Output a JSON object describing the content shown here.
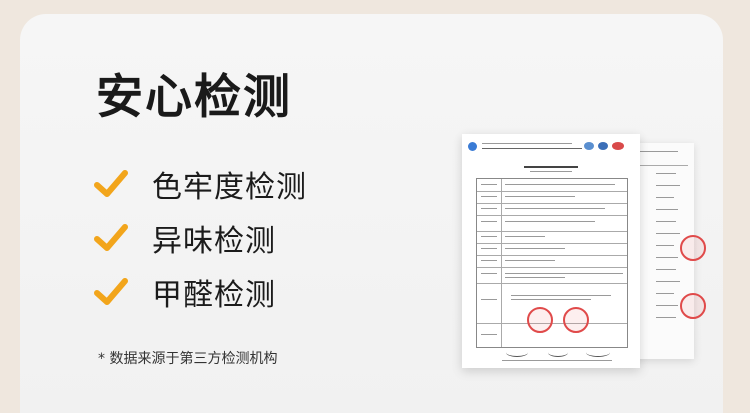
{
  "title": "安心检测",
  "items": [
    {
      "label": "色牢度检测"
    },
    {
      "label": "异味检测"
    },
    {
      "label": "甲醛检测"
    }
  ],
  "note": "* 数据来源于第三方检测机构",
  "colors": {
    "page_bg": "#efe7de",
    "card_bg": "#f4f4f4",
    "check": "#f2a51b",
    "text": "#1a1a1a"
  },
  "icons": [
    "check-icon",
    "stamp-icon"
  ]
}
